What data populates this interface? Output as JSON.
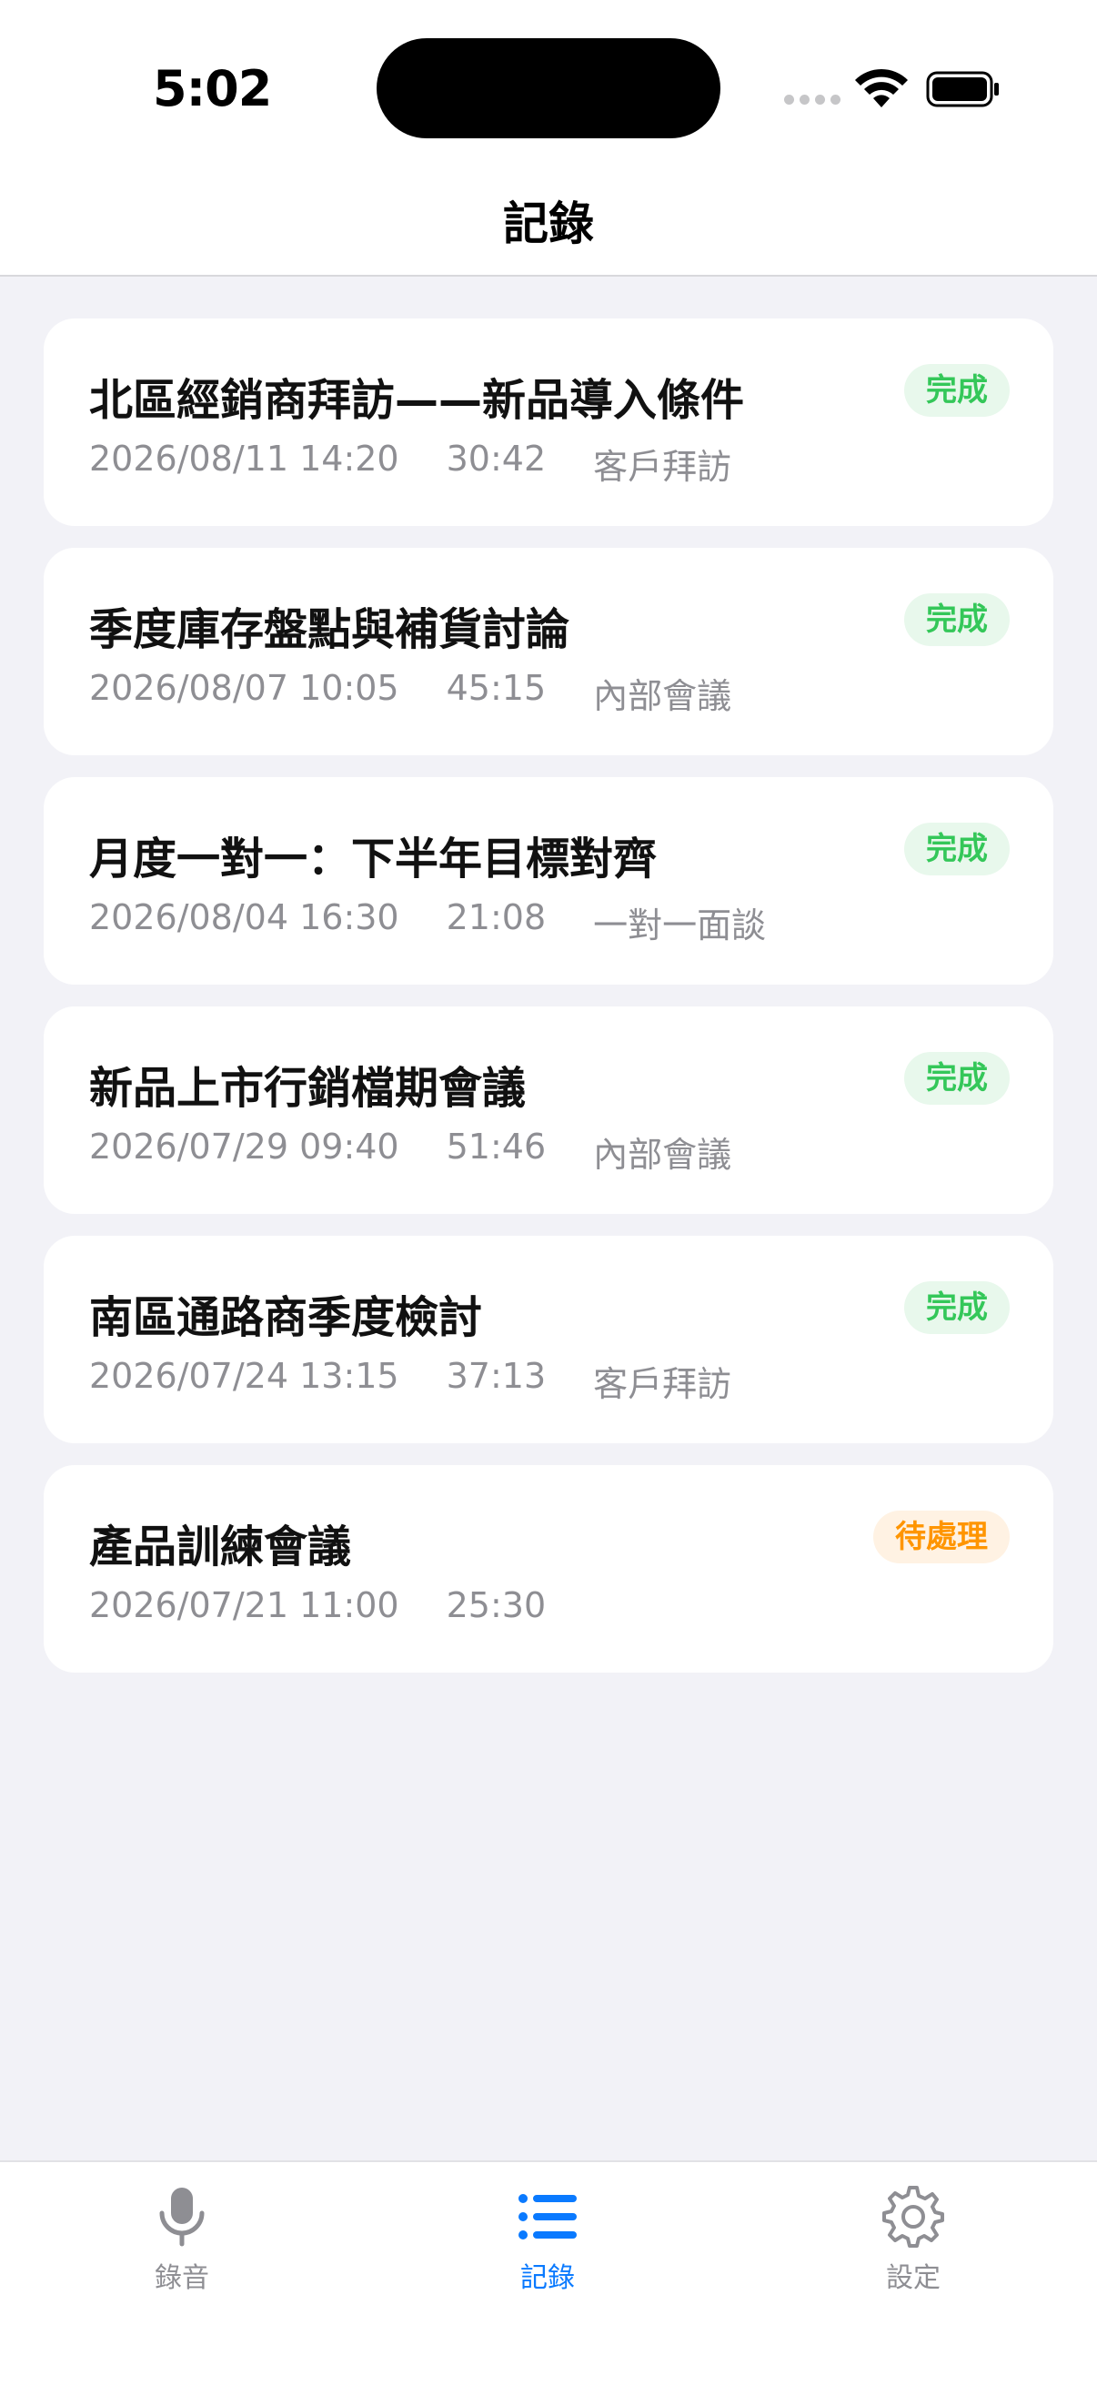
{
  "status_bar": {
    "time": "5:02"
  },
  "header": {
    "title": "記錄"
  },
  "records": [
    {
      "title": "北區經銷商拜訪——新品導入條件",
      "date": "2026/08/11 14:20",
      "duration": "30:42",
      "category": "客戶拜訪",
      "status": "完成",
      "status_type": "done"
    },
    {
      "title": "季度庫存盤點與補貨討論",
      "date": "2026/08/07 10:05",
      "duration": "45:15",
      "category": "內部會議",
      "status": "完成",
      "status_type": "done"
    },
    {
      "title": "月度一對一：下半年目標對齊",
      "date": "2026/08/04 16:30",
      "duration": "21:08",
      "category": "一對一面談",
      "status": "完成",
      "status_type": "done"
    },
    {
      "title": "新品上市行銷檔期會議",
      "date": "2026/07/29 09:40",
      "duration": "51:46",
      "category": "內部會議",
      "status": "完成",
      "status_type": "done"
    },
    {
      "title": "南區通路商季度檢討",
      "date": "2026/07/24 13:15",
      "duration": "37:13",
      "category": "客戶拜訪",
      "status": "完成",
      "status_type": "done"
    },
    {
      "title": "產品訓練會議",
      "date": "2026/07/21 11:00",
      "duration": "25:30",
      "category": "",
      "status": "待處理",
      "status_type": "pending"
    }
  ],
  "tabbar": {
    "record_label": "錄音",
    "list_label": "記錄",
    "settings_label": "設定",
    "active": "list",
    "active_color": "#0a7aff",
    "inactive_color": "#8e8e93"
  },
  "colors": {
    "done": "#34c759",
    "pending": "#ff9500",
    "background": "#f2f2f7"
  },
  "icons": {
    "record": "microphone-icon",
    "list": "list-icon",
    "settings": "gear-icon"
  }
}
